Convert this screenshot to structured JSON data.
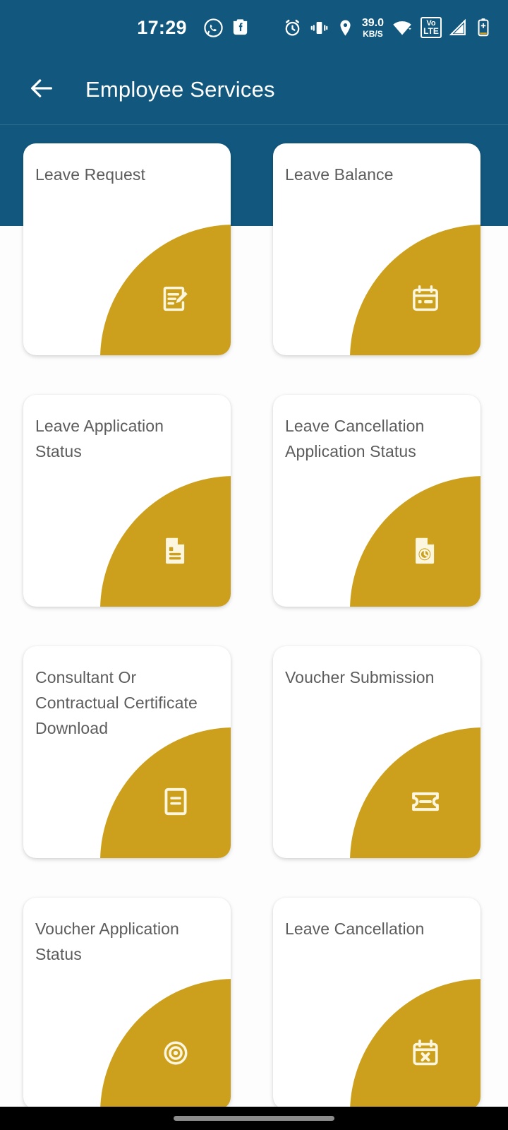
{
  "statusbar": {
    "time": "17:29",
    "network_speed_value": "39.0",
    "network_speed_unit": "KB/S",
    "volte_top": "Vo",
    "volte_bottom": "LTE",
    "icons": [
      "whatsapp-icon",
      "facebook-messenger-icon",
      "alarm-icon",
      "vibrate-icon",
      "location-icon",
      "wifi-icon",
      "volte-icon",
      "cellular-signal-icon",
      "battery-charging-icon"
    ]
  },
  "appbar": {
    "title": "Employee Services",
    "back_icon": "arrow-left-icon"
  },
  "theme": {
    "header_color": "#12587E",
    "accent_color": "#CCA01C",
    "card_color": "#FFFFFF",
    "page_background": "#FDFDFD",
    "title_text_color": "#5C5C5C",
    "navbar_color": "#000000"
  },
  "cards": [
    {
      "title": "Leave Request",
      "icon": "note-edit-icon"
    },
    {
      "title": "Leave Balance",
      "icon": "calendar-icon"
    },
    {
      "title": "Leave Application Status",
      "icon": "document-lines-icon"
    },
    {
      "title": "Leave Cancellation Application Status",
      "icon": "document-history-icon"
    },
    {
      "title": "Consultant Or Contractual Certificate Download",
      "icon": "certificate-icon"
    },
    {
      "title": "Voucher Submission",
      "icon": "ticket-icon"
    },
    {
      "title": "Voucher Application Status",
      "icon": "eye-icon"
    },
    {
      "title": "Leave Cancellation",
      "icon": "calendar-cancel-icon"
    }
  ]
}
